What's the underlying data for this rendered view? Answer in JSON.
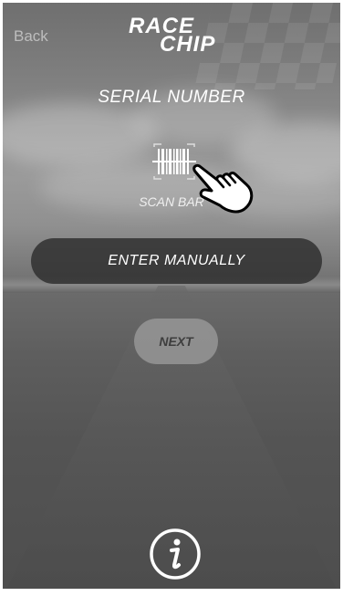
{
  "nav": {
    "back_label": "Back"
  },
  "logo": {
    "line1": "RACE",
    "line2": "CHIP"
  },
  "title": "SERIAL NUMBER",
  "scan": {
    "label": "SCAN BAR",
    "icon": "barcode-icon"
  },
  "buttons": {
    "enter_manually": "ENTER MANUALLY",
    "next": "NEXT"
  },
  "info_icon": "info-icon",
  "hand_icon": "pointing-hand-icon"
}
